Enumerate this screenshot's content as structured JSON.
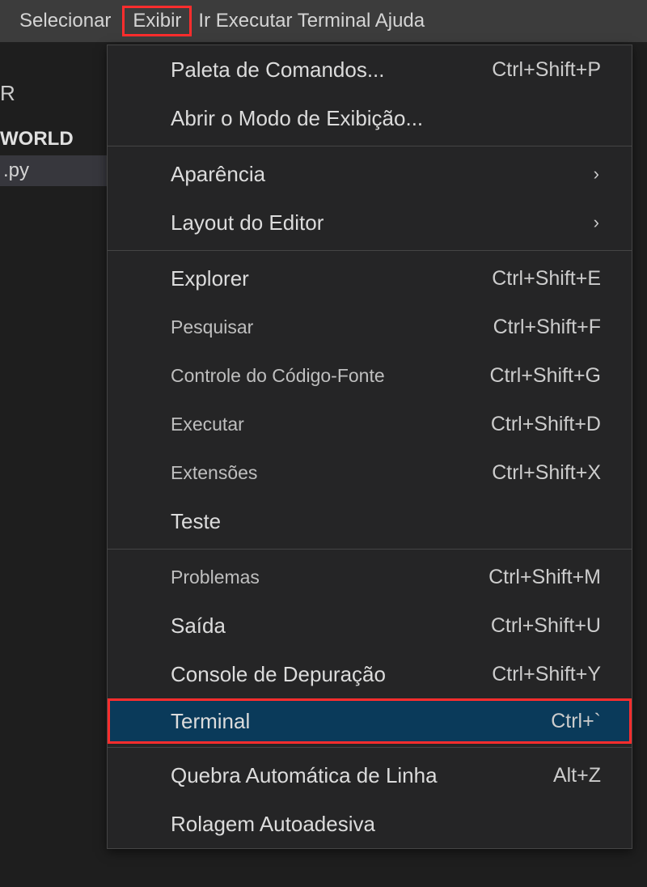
{
  "menubar": {
    "selecionar": "Selecionar",
    "exibir": "Exibir",
    "rest": "Ir Executar Terminal Ajuda"
  },
  "sidebar": {
    "r": "R",
    "world": "WORLD",
    "py": ".py"
  },
  "menu": {
    "palette": {
      "label": "Paleta de Comandos...",
      "sc": "Ctrl+Shift+P"
    },
    "openView": {
      "label": "Abrir o Modo de Exibição...",
      "sc": ""
    },
    "appearance": {
      "label": "Aparência",
      "sc": ""
    },
    "layout": {
      "label": "Layout do Editor",
      "sc": ""
    },
    "explorer": {
      "label": "Explorer",
      "sc": "Ctrl+Shift+E"
    },
    "pesquisar": {
      "label": "Pesquisar",
      "sc": "Ctrl+Shift+F"
    },
    "scm": {
      "label": "Controle do Código-Fonte",
      "sc": "Ctrl+Shift+G"
    },
    "executar": {
      "label": "Executar",
      "sc": "Ctrl+Shift+D"
    },
    "extensoes": {
      "label": "Extensões",
      "sc": "Ctrl+Shift+X"
    },
    "teste": {
      "label": "Teste",
      "sc": ""
    },
    "problemas": {
      "label": "Problemas",
      "sc": "Ctrl+Shift+M"
    },
    "saida": {
      "label": "Saída",
      "sc": "Ctrl+Shift+U"
    },
    "console": {
      "label": "Console de Depuração",
      "sc": "Ctrl+Shift+Y"
    },
    "terminal": {
      "label": "Terminal",
      "sc": "Ctrl+`"
    },
    "wrap": {
      "label": "Quebra Automática de Linha",
      "sc": "Alt+Z"
    },
    "sticky": {
      "label": "Rolagem Autoadesiva",
      "sc": ""
    }
  },
  "chevron": "›"
}
